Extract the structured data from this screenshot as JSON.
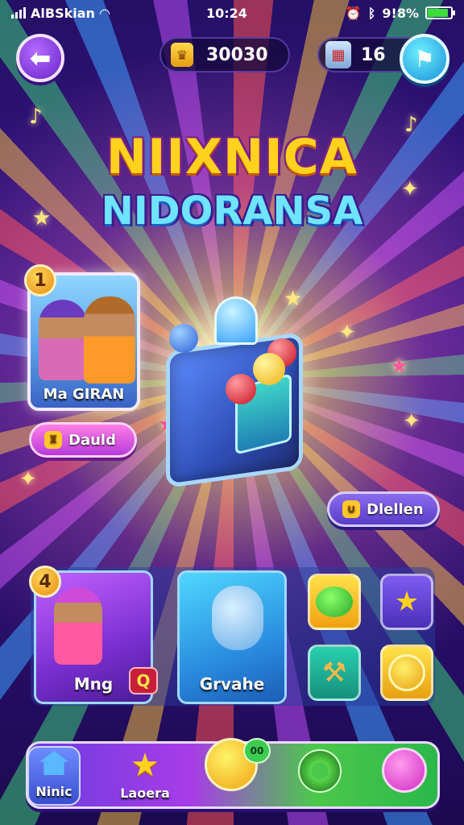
{
  "status_bar": {
    "carrier": "AlBSkian",
    "time": "10:24",
    "battery": "9!8%",
    "battery_level": 0.9
  },
  "top_bar": {
    "coins": "30030",
    "tickets": "16"
  },
  "title": {
    "line1": "NIIXNICA",
    "line2": "NIDORANSA"
  },
  "featured": {
    "badge": "1",
    "card_label": "Ma GIRAN",
    "button_label": "Dauld"
  },
  "collect_button": {
    "label": "Dlellen"
  },
  "modes": {
    "badge": "4",
    "minigames_label": "Mng",
    "q_badge": "Q",
    "giveaway_label": "Grvahe"
  },
  "nav": {
    "home_label": "Ninic",
    "leaderboard_label": "Laoera",
    "orb_tag": "00"
  },
  "colors": {
    "accent_purple": "#7a2fd0",
    "accent_blue": "#1690d8",
    "gold": "#ffd21e"
  }
}
